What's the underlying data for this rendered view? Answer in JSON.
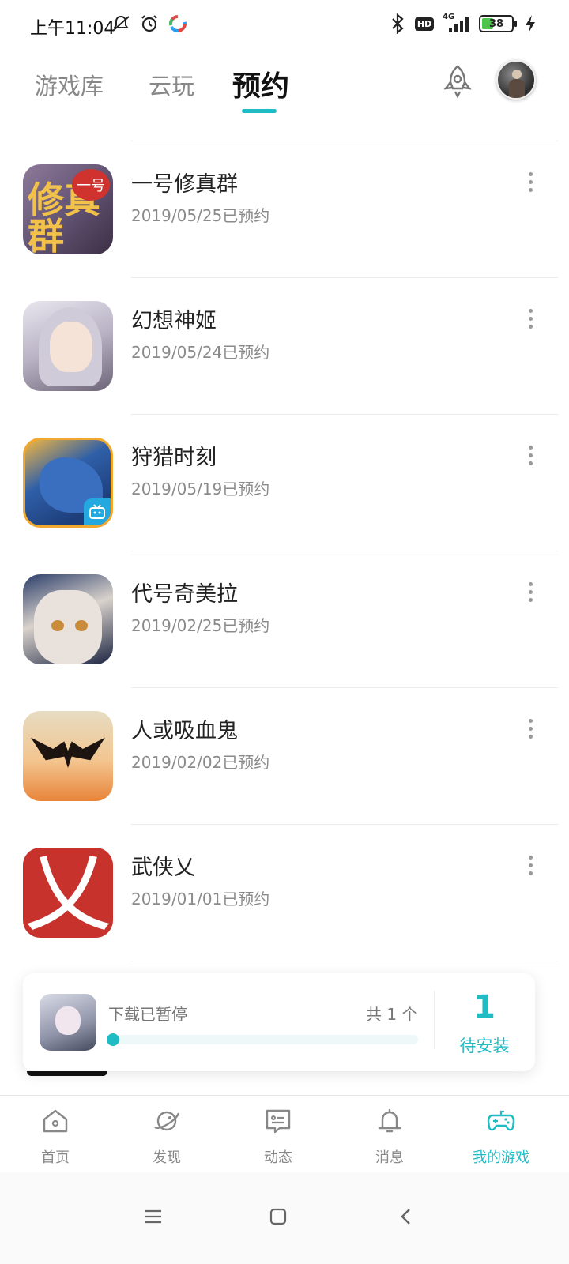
{
  "status_bar": {
    "time": "上午11:04",
    "left_icons": [
      "mute-icon",
      "alarm-icon",
      "app-notification-icon"
    ],
    "right_icons": [
      "bluetooth-icon",
      "hd-icon",
      "signal-4g-icon",
      "battery-icon",
      "charging-icon"
    ],
    "hd_label": "HD",
    "network_label": "4G",
    "battery_level": "38"
  },
  "header": {
    "tabs": [
      {
        "label": "游戏库",
        "active": false
      },
      {
        "label": "云玩",
        "active": false
      },
      {
        "label": "预约",
        "active": true
      }
    ],
    "accent_color": "#1fbcc4"
  },
  "reservations": [
    {
      "title": "一号修真群",
      "date": "2019/05/25已预约",
      "icon_text": "修真群",
      "icon_badge": "一号"
    },
    {
      "title": "幻想神姬",
      "date": "2019/05/24已预约"
    },
    {
      "title": "狩猎时刻",
      "date": "2019/05/19已预约"
    },
    {
      "title": "代号奇美拉",
      "date": "2019/02/25已预约"
    },
    {
      "title": "人或吸血鬼",
      "date": "2019/02/02已预约"
    },
    {
      "title": "武侠乂",
      "date": "2019/01/01已预约",
      "icon_text": "乂"
    }
  ],
  "download": {
    "status": "下载已暂停",
    "total": "共 1 个",
    "progress": 0.0,
    "pending_count": "1",
    "pending_label": "待安装"
  },
  "bottom_nav": [
    {
      "label": "首页",
      "icon": "home-icon",
      "active": false
    },
    {
      "label": "发现",
      "icon": "planet-icon",
      "active": false
    },
    {
      "label": "动态",
      "icon": "message-card-icon",
      "active": false
    },
    {
      "label": "消息",
      "icon": "bell-icon",
      "active": false
    },
    {
      "label": "我的游戏",
      "icon": "gamepad-icon",
      "active": true
    }
  ]
}
